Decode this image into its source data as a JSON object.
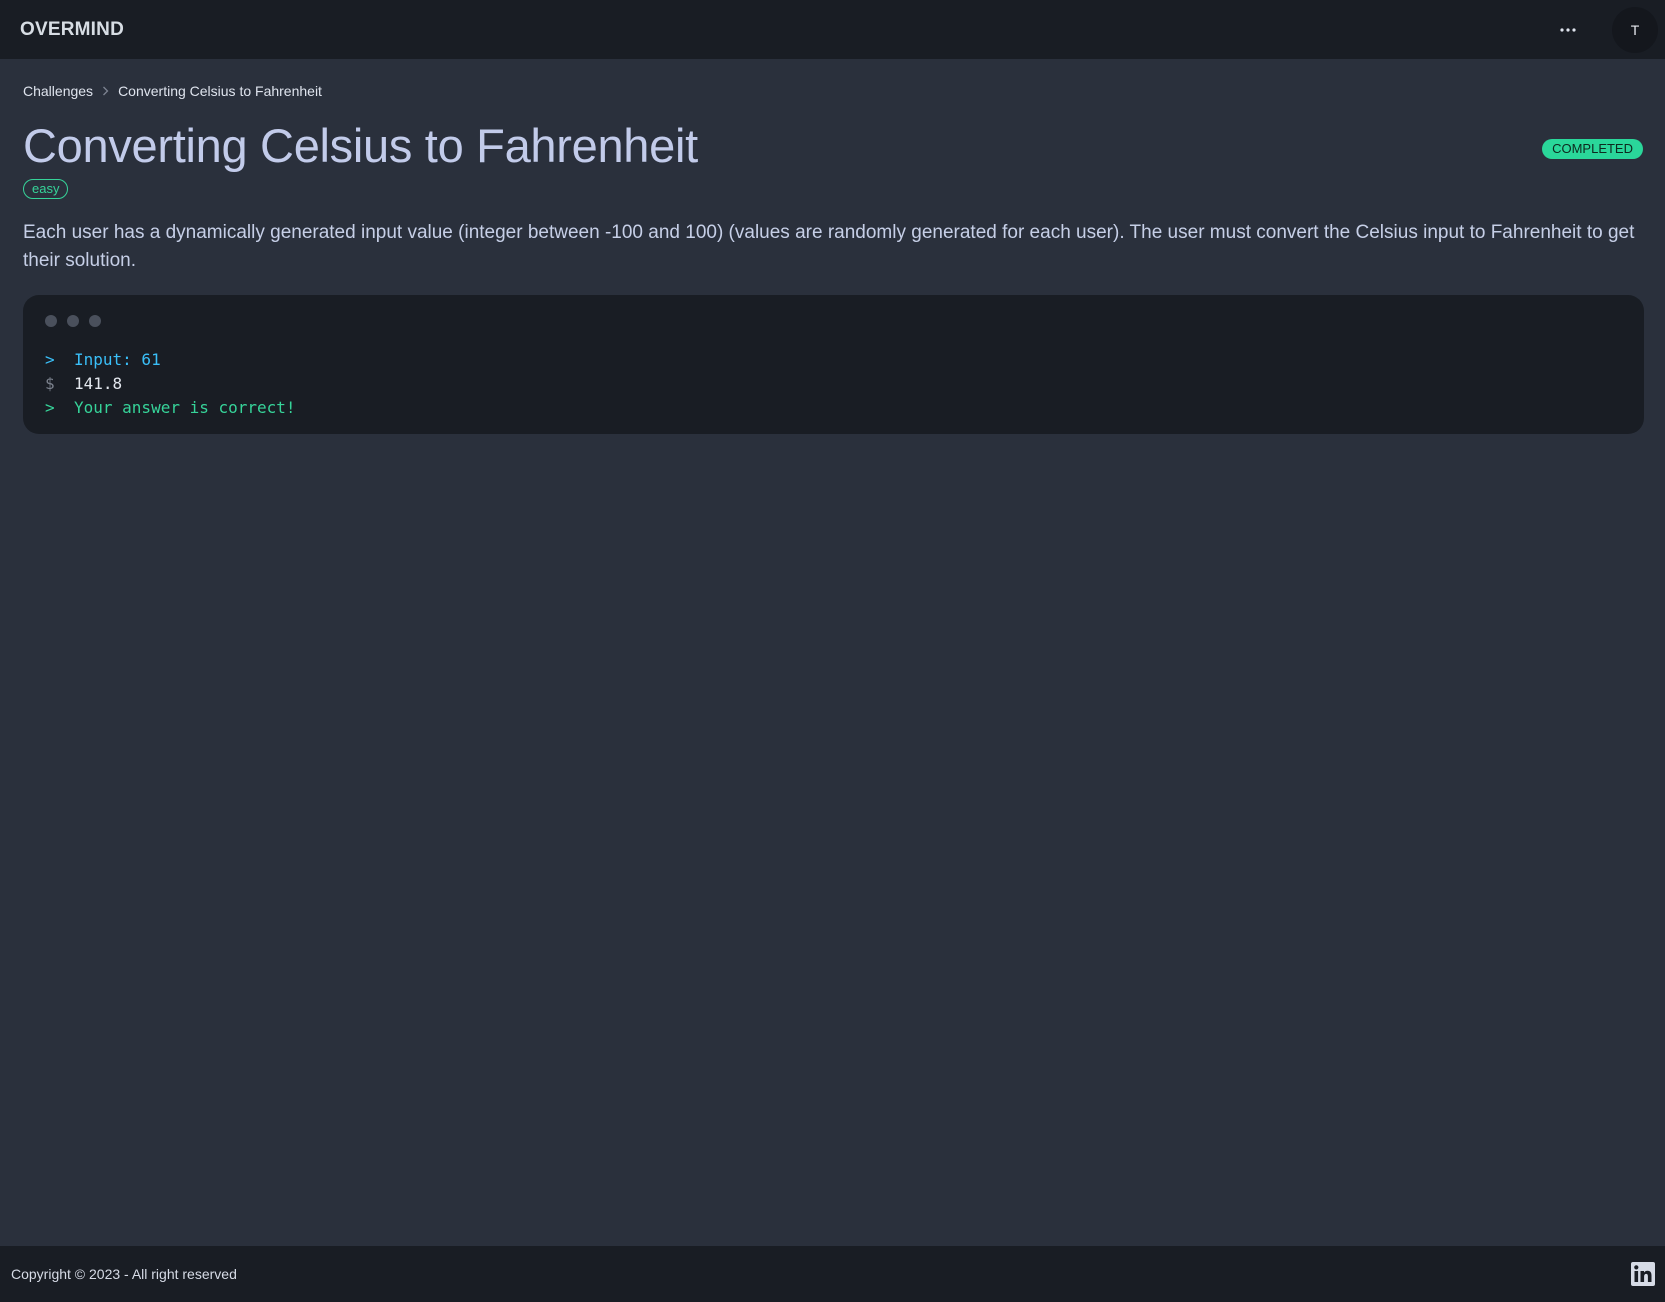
{
  "navbar": {
    "brand": "OVERMIND",
    "avatar_initial": "T",
    "more_icon": "ellipsis-icon"
  },
  "breadcrumb": {
    "items": [
      "Challenges",
      "Converting Celsius to Fahrenheit"
    ],
    "separator_icon": "chevron-right-icon"
  },
  "challenge": {
    "title": "Converting Celsius to Fahrenheit",
    "status": "COMPLETED",
    "difficulty": "easy",
    "description": "Each user has a dynamically generated input value (integer between -100 and 100) (values are randomly generated for each user). The user must convert the Celsius input to Fahrenheit to get their solution."
  },
  "terminal": {
    "lines": [
      {
        "prefix": ">",
        "text": "Input: 61"
      },
      {
        "prefix": "$",
        "text": "141.8"
      },
      {
        "prefix": ">",
        "text": "Your answer is correct!"
      }
    ]
  },
  "footer": {
    "copyright": "Copyright © 2023 - All right reserved",
    "social_icon": "linkedin-icon"
  },
  "colors": {
    "background": "#2a303c",
    "surface": "#191d24",
    "success": "#36d399",
    "info": "#3abff8",
    "title": "#c2cbea"
  }
}
